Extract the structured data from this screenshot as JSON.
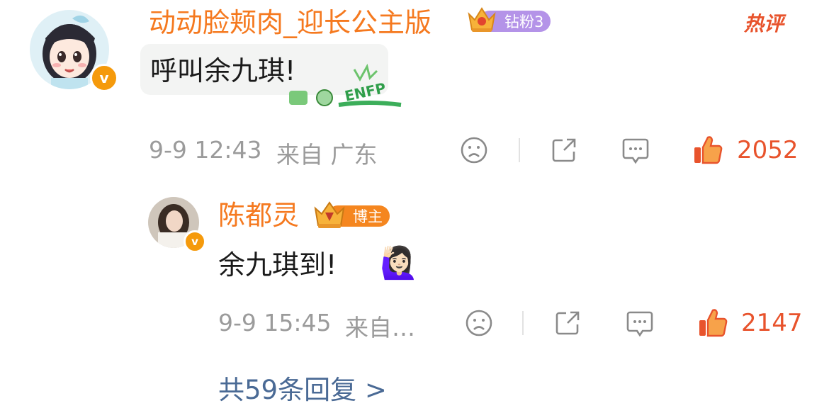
{
  "comment": {
    "username": "动动脸颊肉_迎长公主版",
    "fan_badge": "钻粉3",
    "hot_tag": "热评",
    "text": "呼叫余九琪!",
    "sticker_text": "ENFP",
    "date": "9-9 12:43",
    "location": "来自 广东",
    "likes": "2052"
  },
  "reply": {
    "username": "陈都灵",
    "role_badge": "博主",
    "text": "余九琪到!",
    "emoji": "🙋🏻‍♀️",
    "date": "9-9 15:45",
    "location": "来自…",
    "likes": "2147"
  },
  "more_replies": "共59条回复 >",
  "colors": {
    "username": "#f5791f",
    "like": "#e8532c",
    "meta": "#9b9b9b",
    "fan_badge": "#b493e8",
    "role_badge": "#f5861f",
    "more_link": "#4a6a95",
    "verified": "#f59a0c"
  },
  "icons": [
    "dislike-icon",
    "share-icon",
    "reply-icon",
    "like-icon",
    "verified-icon",
    "crown-icon"
  ]
}
